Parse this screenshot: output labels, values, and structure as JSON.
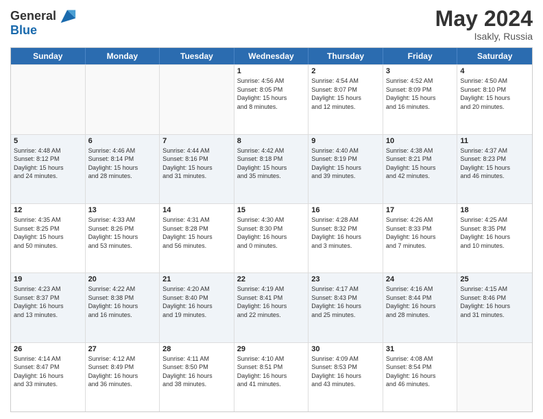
{
  "header": {
    "logo_line1": "General",
    "logo_line2": "Blue",
    "month": "May 2024",
    "location": "Isakly, Russia"
  },
  "days_of_week": [
    "Sunday",
    "Monday",
    "Tuesday",
    "Wednesday",
    "Thursday",
    "Friday",
    "Saturday"
  ],
  "weeks": [
    [
      {
        "day": "",
        "empty": true
      },
      {
        "day": "",
        "empty": true
      },
      {
        "day": "",
        "empty": true
      },
      {
        "day": "1",
        "lines": [
          "Sunrise: 4:56 AM",
          "Sunset: 8:05 PM",
          "Daylight: 15 hours",
          "and 8 minutes."
        ]
      },
      {
        "day": "2",
        "lines": [
          "Sunrise: 4:54 AM",
          "Sunset: 8:07 PM",
          "Daylight: 15 hours",
          "and 12 minutes."
        ]
      },
      {
        "day": "3",
        "lines": [
          "Sunrise: 4:52 AM",
          "Sunset: 8:09 PM",
          "Daylight: 15 hours",
          "and 16 minutes."
        ]
      },
      {
        "day": "4",
        "lines": [
          "Sunrise: 4:50 AM",
          "Sunset: 8:10 PM",
          "Daylight: 15 hours",
          "and 20 minutes."
        ]
      }
    ],
    [
      {
        "day": "5",
        "lines": [
          "Sunrise: 4:48 AM",
          "Sunset: 8:12 PM",
          "Daylight: 15 hours",
          "and 24 minutes."
        ]
      },
      {
        "day": "6",
        "lines": [
          "Sunrise: 4:46 AM",
          "Sunset: 8:14 PM",
          "Daylight: 15 hours",
          "and 28 minutes."
        ]
      },
      {
        "day": "7",
        "lines": [
          "Sunrise: 4:44 AM",
          "Sunset: 8:16 PM",
          "Daylight: 15 hours",
          "and 31 minutes."
        ]
      },
      {
        "day": "8",
        "lines": [
          "Sunrise: 4:42 AM",
          "Sunset: 8:18 PM",
          "Daylight: 15 hours",
          "and 35 minutes."
        ]
      },
      {
        "day": "9",
        "lines": [
          "Sunrise: 4:40 AM",
          "Sunset: 8:19 PM",
          "Daylight: 15 hours",
          "and 39 minutes."
        ]
      },
      {
        "day": "10",
        "lines": [
          "Sunrise: 4:38 AM",
          "Sunset: 8:21 PM",
          "Daylight: 15 hours",
          "and 42 minutes."
        ]
      },
      {
        "day": "11",
        "lines": [
          "Sunrise: 4:37 AM",
          "Sunset: 8:23 PM",
          "Daylight: 15 hours",
          "and 46 minutes."
        ]
      }
    ],
    [
      {
        "day": "12",
        "lines": [
          "Sunrise: 4:35 AM",
          "Sunset: 8:25 PM",
          "Daylight: 15 hours",
          "and 50 minutes."
        ]
      },
      {
        "day": "13",
        "lines": [
          "Sunrise: 4:33 AM",
          "Sunset: 8:26 PM",
          "Daylight: 15 hours",
          "and 53 minutes."
        ]
      },
      {
        "day": "14",
        "lines": [
          "Sunrise: 4:31 AM",
          "Sunset: 8:28 PM",
          "Daylight: 15 hours",
          "and 56 minutes."
        ]
      },
      {
        "day": "15",
        "lines": [
          "Sunrise: 4:30 AM",
          "Sunset: 8:30 PM",
          "Daylight: 16 hours",
          "and 0 minutes."
        ]
      },
      {
        "day": "16",
        "lines": [
          "Sunrise: 4:28 AM",
          "Sunset: 8:32 PM",
          "Daylight: 16 hours",
          "and 3 minutes."
        ]
      },
      {
        "day": "17",
        "lines": [
          "Sunrise: 4:26 AM",
          "Sunset: 8:33 PM",
          "Daylight: 16 hours",
          "and 7 minutes."
        ]
      },
      {
        "day": "18",
        "lines": [
          "Sunrise: 4:25 AM",
          "Sunset: 8:35 PM",
          "Daylight: 16 hours",
          "and 10 minutes."
        ]
      }
    ],
    [
      {
        "day": "19",
        "lines": [
          "Sunrise: 4:23 AM",
          "Sunset: 8:37 PM",
          "Daylight: 16 hours",
          "and 13 minutes."
        ]
      },
      {
        "day": "20",
        "lines": [
          "Sunrise: 4:22 AM",
          "Sunset: 8:38 PM",
          "Daylight: 16 hours",
          "and 16 minutes."
        ]
      },
      {
        "day": "21",
        "lines": [
          "Sunrise: 4:20 AM",
          "Sunset: 8:40 PM",
          "Daylight: 16 hours",
          "and 19 minutes."
        ]
      },
      {
        "day": "22",
        "lines": [
          "Sunrise: 4:19 AM",
          "Sunset: 8:41 PM",
          "Daylight: 16 hours",
          "and 22 minutes."
        ]
      },
      {
        "day": "23",
        "lines": [
          "Sunrise: 4:17 AM",
          "Sunset: 8:43 PM",
          "Daylight: 16 hours",
          "and 25 minutes."
        ]
      },
      {
        "day": "24",
        "lines": [
          "Sunrise: 4:16 AM",
          "Sunset: 8:44 PM",
          "Daylight: 16 hours",
          "and 28 minutes."
        ]
      },
      {
        "day": "25",
        "lines": [
          "Sunrise: 4:15 AM",
          "Sunset: 8:46 PM",
          "Daylight: 16 hours",
          "and 31 minutes."
        ]
      }
    ],
    [
      {
        "day": "26",
        "lines": [
          "Sunrise: 4:14 AM",
          "Sunset: 8:47 PM",
          "Daylight: 16 hours",
          "and 33 minutes."
        ]
      },
      {
        "day": "27",
        "lines": [
          "Sunrise: 4:12 AM",
          "Sunset: 8:49 PM",
          "Daylight: 16 hours",
          "and 36 minutes."
        ]
      },
      {
        "day": "28",
        "lines": [
          "Sunrise: 4:11 AM",
          "Sunset: 8:50 PM",
          "Daylight: 16 hours",
          "and 38 minutes."
        ]
      },
      {
        "day": "29",
        "lines": [
          "Sunrise: 4:10 AM",
          "Sunset: 8:51 PM",
          "Daylight: 16 hours",
          "and 41 minutes."
        ]
      },
      {
        "day": "30",
        "lines": [
          "Sunrise: 4:09 AM",
          "Sunset: 8:53 PM",
          "Daylight: 16 hours",
          "and 43 minutes."
        ]
      },
      {
        "day": "31",
        "lines": [
          "Sunrise: 4:08 AM",
          "Sunset: 8:54 PM",
          "Daylight: 16 hours",
          "and 46 minutes."
        ]
      },
      {
        "day": "",
        "empty": true
      }
    ]
  ]
}
